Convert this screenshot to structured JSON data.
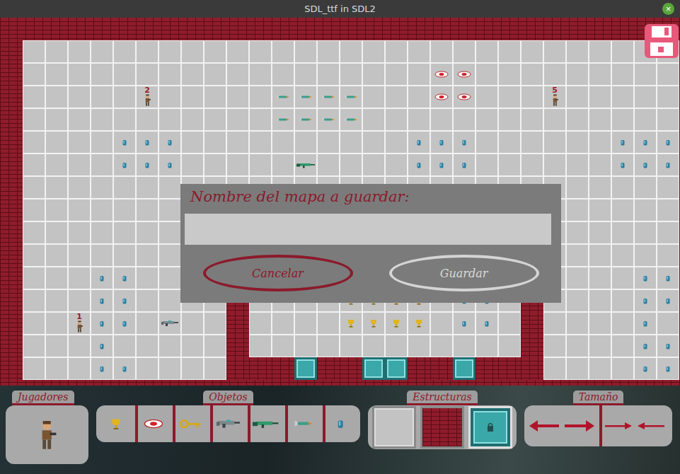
{
  "window": {
    "title": "SDL_ttf in SDL2",
    "close": "×"
  },
  "map": {
    "cols": 29,
    "rows": 15,
    "structures": [
      {
        "kind": "wall",
        "col": 9,
        "row": 11
      },
      {
        "kind": "wall",
        "col": 9,
        "row": 12
      },
      {
        "kind": "wall",
        "col": 9,
        "row": 13
      },
      {
        "kind": "wall",
        "col": 9,
        "row": 14
      },
      {
        "kind": "wall",
        "col": 22,
        "row": 11
      },
      {
        "kind": "wall",
        "col": 22,
        "row": 12
      },
      {
        "kind": "wall",
        "col": 22,
        "row": 13
      },
      {
        "kind": "wall",
        "col": 22,
        "row": 14
      },
      {
        "kind": "wall",
        "col": 10,
        "row": 14
      },
      {
        "kind": "wall",
        "col": 11,
        "row": 14
      },
      {
        "kind": "door",
        "col": 12,
        "row": 14
      },
      {
        "kind": "wall",
        "col": 13,
        "row": 14
      },
      {
        "kind": "wall",
        "col": 14,
        "row": 14
      },
      {
        "kind": "door",
        "col": 15,
        "row": 14
      },
      {
        "kind": "door",
        "col": 16,
        "row": 14
      },
      {
        "kind": "wall",
        "col": 17,
        "row": 14
      },
      {
        "kind": "wall",
        "col": 18,
        "row": 14
      },
      {
        "kind": "door",
        "col": 19,
        "row": 14
      },
      {
        "kind": "wall",
        "col": 20,
        "row": 14
      },
      {
        "kind": "wall",
        "col": 21,
        "row": 14
      }
    ],
    "objects": [
      {
        "kind": "player",
        "col": 5,
        "row": 2,
        "label": "2"
      },
      {
        "kind": "player",
        "col": 23,
        "row": 2,
        "label": "5"
      },
      {
        "kind": "player",
        "col": 2,
        "row": 12,
        "label": "1"
      },
      {
        "kind": "medkit",
        "col": 18,
        "row": 1
      },
      {
        "kind": "medkit",
        "col": 19,
        "row": 1
      },
      {
        "kind": "medkit",
        "col": 18,
        "row": 2
      },
      {
        "kind": "medkit",
        "col": 19,
        "row": 2
      },
      {
        "kind": "rocket",
        "col": 11,
        "row": 2
      },
      {
        "kind": "rocket",
        "col": 12,
        "row": 2
      },
      {
        "kind": "rocket",
        "col": 13,
        "row": 2
      },
      {
        "kind": "rocket",
        "col": 14,
        "row": 2
      },
      {
        "kind": "rocket",
        "col": 11,
        "row": 3
      },
      {
        "kind": "rocket",
        "col": 12,
        "row": 3
      },
      {
        "kind": "rocket",
        "col": 13,
        "row": 3
      },
      {
        "kind": "rocket",
        "col": 14,
        "row": 3
      },
      {
        "kind": "bullet",
        "col": 4,
        "row": 4
      },
      {
        "kind": "bullet",
        "col": 5,
        "row": 4
      },
      {
        "kind": "bullet",
        "col": 6,
        "row": 4
      },
      {
        "kind": "bullet",
        "col": 4,
        "row": 5
      },
      {
        "kind": "bullet",
        "col": 5,
        "row": 5
      },
      {
        "kind": "bullet",
        "col": 6,
        "row": 5
      },
      {
        "kind": "bullet",
        "col": 17,
        "row": 4
      },
      {
        "kind": "bullet",
        "col": 18,
        "row": 4
      },
      {
        "kind": "bullet",
        "col": 19,
        "row": 4
      },
      {
        "kind": "bullet",
        "col": 17,
        "row": 5
      },
      {
        "kind": "bullet",
        "col": 18,
        "row": 5
      },
      {
        "kind": "bullet",
        "col": 19,
        "row": 5
      },
      {
        "kind": "bullet",
        "col": 26,
        "row": 4
      },
      {
        "kind": "bullet",
        "col": 27,
        "row": 4
      },
      {
        "kind": "bullet",
        "col": 28,
        "row": 4
      },
      {
        "kind": "bullet",
        "col": 26,
        "row": 5
      },
      {
        "kind": "bullet",
        "col": 27,
        "row": 5
      },
      {
        "kind": "bullet",
        "col": 28,
        "row": 5
      },
      {
        "kind": "rifle",
        "col": 12,
        "row": 5
      },
      {
        "kind": "bullet",
        "col": 3,
        "row": 10
      },
      {
        "kind": "bullet",
        "col": 4,
        "row": 10
      },
      {
        "kind": "bullet",
        "col": 3,
        "row": 11
      },
      {
        "kind": "bullet",
        "col": 4,
        "row": 11
      },
      {
        "kind": "bullet",
        "col": 3,
        "row": 12
      },
      {
        "kind": "bullet",
        "col": 4,
        "row": 12
      },
      {
        "kind": "bullet",
        "col": 3,
        "row": 13
      },
      {
        "kind": "bullet",
        "col": 3,
        "row": 14
      },
      {
        "kind": "bullet",
        "col": 4,
        "row": 14
      },
      {
        "kind": "machinegun",
        "col": 6,
        "row": 12
      },
      {
        "kind": "trophy",
        "col": 14,
        "row": 11
      },
      {
        "kind": "trophy",
        "col": 15,
        "row": 11
      },
      {
        "kind": "trophy",
        "col": 16,
        "row": 11
      },
      {
        "kind": "trophy",
        "col": 17,
        "row": 11
      },
      {
        "kind": "trophy",
        "col": 14,
        "row": 12
      },
      {
        "kind": "trophy",
        "col": 15,
        "row": 12
      },
      {
        "kind": "trophy",
        "col": 16,
        "row": 12
      },
      {
        "kind": "trophy",
        "col": 17,
        "row": 12
      },
      {
        "kind": "bullet",
        "col": 19,
        "row": 11
      },
      {
        "kind": "bullet",
        "col": 20,
        "row": 11
      },
      {
        "kind": "bullet",
        "col": 19,
        "row": 12
      },
      {
        "kind": "bullet",
        "col": 20,
        "row": 12
      },
      {
        "kind": "bullet",
        "col": 27,
        "row": 10
      },
      {
        "kind": "bullet",
        "col": 28,
        "row": 10
      },
      {
        "kind": "bullet",
        "col": 27,
        "row": 11
      },
      {
        "kind": "bullet",
        "col": 28,
        "row": 11
      },
      {
        "kind": "bullet",
        "col": 27,
        "row": 12
      },
      {
        "kind": "bullet",
        "col": 27,
        "row": 13
      },
      {
        "kind": "bullet",
        "col": 28,
        "row": 13
      },
      {
        "kind": "bullet",
        "col": 27,
        "row": 14
      },
      {
        "kind": "bullet",
        "col": 28,
        "row": 14
      }
    ]
  },
  "dialog": {
    "title": "Nombre del mapa a guardar:",
    "input": {
      "value": ""
    },
    "buttons": [
      {
        "label": "Cancelar",
        "disabled": false
      },
      {
        "label": "Guardar",
        "disabled": true
      }
    ]
  },
  "toolbar": [
    {
      "kind": "players",
      "title": "Jugadores",
      "items": [
        {
          "kind": "player",
          "selected": false
        }
      ]
    },
    {
      "kind": "objects",
      "title": "Objetos",
      "items": [
        {
          "kind": "trophy",
          "selected": false
        },
        {
          "kind": "medkit",
          "selected": false
        },
        {
          "kind": "key",
          "selected": false
        },
        {
          "kind": "machinegun",
          "selected": false
        },
        {
          "kind": "rifle",
          "selected": false
        },
        {
          "kind": "rocket",
          "selected": false
        },
        {
          "kind": "bullet",
          "selected": false
        }
      ]
    },
    {
      "kind": "structures",
      "title": "Estructuras",
      "items": [
        {
          "kind": "floor",
          "selected": false
        },
        {
          "kind": "wall",
          "selected": false
        },
        {
          "kind": "door",
          "selected": true
        }
      ]
    },
    {
      "kind": "size",
      "title": "Tamaño",
      "items": [
        {
          "kind": "expand",
          "selected": false
        },
        {
          "kind": "shrink",
          "selected": false
        }
      ]
    }
  ]
}
